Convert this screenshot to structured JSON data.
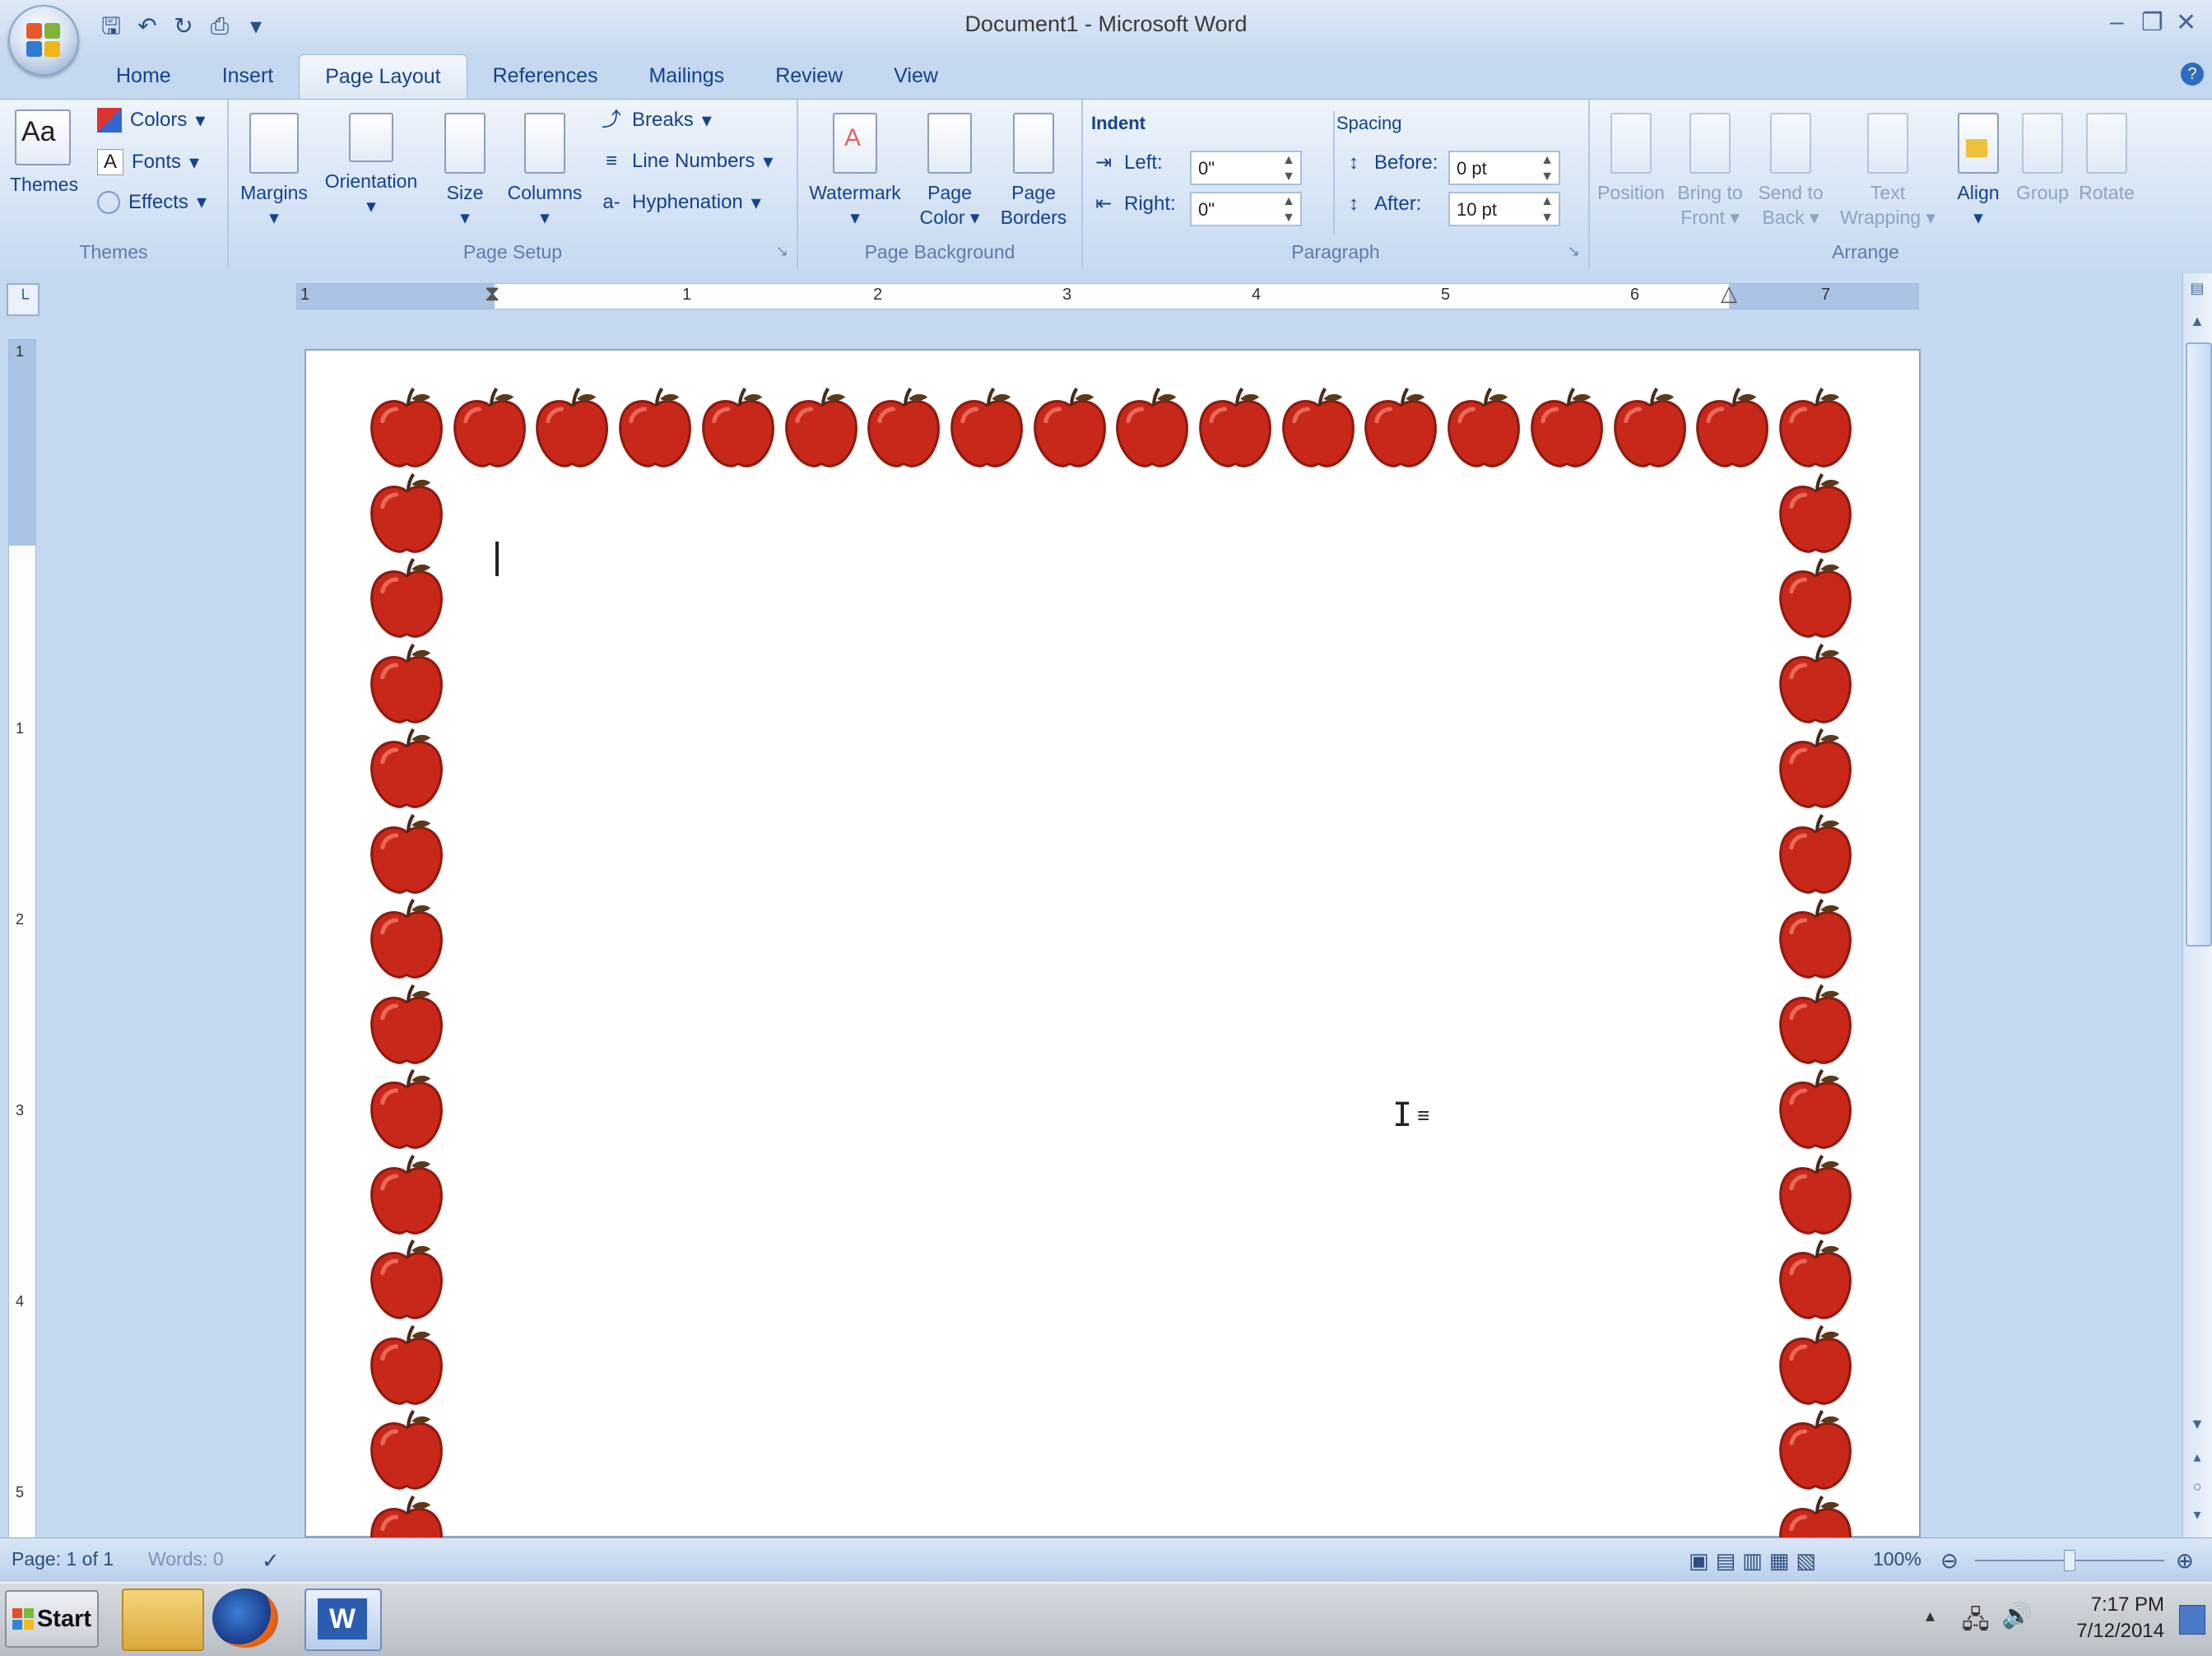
{
  "window": {
    "title": "Document1 - Microsoft Word"
  },
  "quick_access": {
    "icons": [
      "save-icon",
      "undo-icon",
      "redo-icon",
      "print-preview-icon",
      "customize-icon"
    ]
  },
  "tabs": [
    {
      "label": "Home",
      "active": false
    },
    {
      "label": "Insert",
      "active": false
    },
    {
      "label": "Page Layout",
      "active": true
    },
    {
      "label": "References",
      "active": false
    },
    {
      "label": "Mailings",
      "active": false
    },
    {
      "label": "Review",
      "active": false
    },
    {
      "label": "View",
      "active": false
    }
  ],
  "ribbon": {
    "themes": {
      "group_label": "Themes",
      "themes_label": "Themes",
      "colors_label": "Colors",
      "fonts_label": "Fonts",
      "effects_label": "Effects"
    },
    "page_setup": {
      "group_label": "Page Setup",
      "margins": "Margins",
      "orientation": "Orientation",
      "size": "Size",
      "columns": "Columns",
      "breaks": "Breaks",
      "line_numbers": "Line Numbers",
      "hyphenation": "Hyphenation"
    },
    "page_background": {
      "group_label": "Page Background",
      "watermark": "Watermark",
      "page_color_1": "Page",
      "page_color_2": "Color",
      "page_borders_1": "Page",
      "page_borders_2": "Borders"
    },
    "paragraph": {
      "group_label": "Paragraph",
      "indent_label": "Indent",
      "left_label": "Left:",
      "left_value": "0\"",
      "right_label": "Right:",
      "right_value": "0\"",
      "spacing_label": "Spacing",
      "before_label": "Before:",
      "before_value": "0 pt",
      "after_label": "After:",
      "after_value": "10 pt"
    },
    "arrange": {
      "group_label": "Arrange",
      "position": "Position",
      "bring_front_1": "Bring to",
      "bring_front_2": "Front",
      "send_back_1": "Send to",
      "send_back_2": "Back",
      "text_wrap_1": "Text",
      "text_wrap_2": "Wrapping",
      "align": "Align",
      "group": "Group",
      "rotate": "Rotate"
    }
  },
  "ruler": {
    "h_numbers": [
      "1",
      "1",
      "2",
      "3",
      "4",
      "5",
      "6",
      "7"
    ],
    "v_numbers": [
      "1",
      "1",
      "2",
      "3",
      "4",
      "5"
    ]
  },
  "status": {
    "page": "Page: 1 of 1",
    "words": "Words: 0",
    "zoom": "100%"
  },
  "taskbar": {
    "start_label": "Start",
    "time": "7:17 PM",
    "date": "7/12/2014"
  },
  "colors": {
    "apple_red": "#c8281a",
    "ribbon_text": "#15428b",
    "page": "#ffffff"
  }
}
